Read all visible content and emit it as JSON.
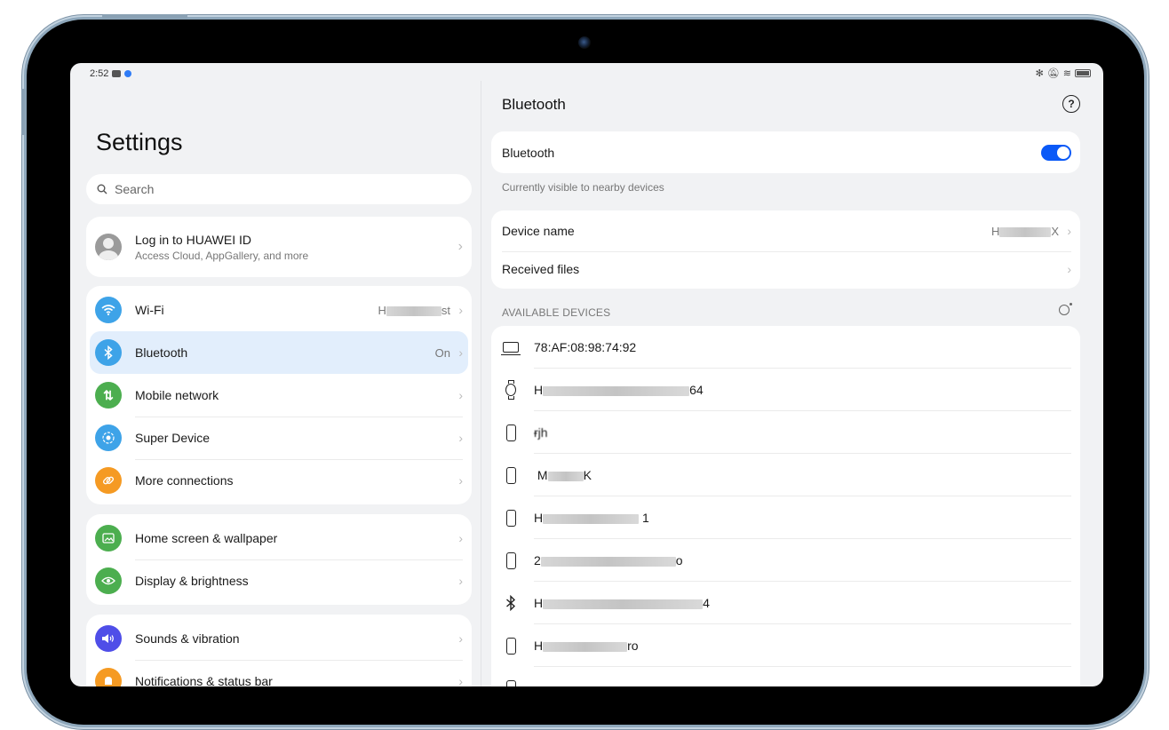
{
  "status_bar": {
    "time": "2:52",
    "right_icons": [
      "bluetooth-icon",
      "mute-icon",
      "wifi-icon",
      "battery-icon"
    ]
  },
  "left": {
    "title": "Settings",
    "search": {
      "placeholder": "Search"
    },
    "account": {
      "title": "Log in to HUAWEI ID",
      "subtitle": "Access Cloud, AppGallery, and more"
    },
    "groups": [
      {
        "items": [
          {
            "label": "Wi-Fi",
            "value_prefix": "H",
            "value_suffix": "st",
            "icon": "wifi-icon",
            "color": "#3ea3e8"
          },
          {
            "label": "Bluetooth",
            "value": "On",
            "icon": "bluetooth-icon",
            "color": "#3ea3e8",
            "selected": true
          },
          {
            "label": "Mobile network",
            "icon": "mobile-data-icon",
            "color": "#4cae4f"
          },
          {
            "label": "Super Device",
            "icon": "super-device-icon",
            "color": "#3ea3e8"
          },
          {
            "label": "More connections",
            "icon": "link-icon",
            "color": "#f59a23"
          }
        ]
      },
      {
        "items": [
          {
            "label": "Home screen & wallpaper",
            "icon": "wallpaper-icon",
            "color": "#4cae4f"
          },
          {
            "label": "Display & brightness",
            "icon": "eye-icon",
            "color": "#4cae4f"
          }
        ]
      },
      {
        "items": [
          {
            "label": "Sounds & vibration",
            "icon": "speaker-icon",
            "color": "#4f4ee8"
          },
          {
            "label": "Notifications & status bar",
            "icon": "bell-icon",
            "color": "#f59a23"
          }
        ]
      }
    ]
  },
  "right": {
    "header": "Bluetooth",
    "toggle_label": "Bluetooth",
    "toggle_on": true,
    "visibility_note": "Currently visible to nearby devices",
    "device_name_label": "Device name",
    "device_name_prefix": "H",
    "device_name_suffix": "X",
    "received_files_label": "Received files",
    "available_header": "AVAILABLE DEVICES",
    "devices": [
      {
        "type": "laptop",
        "name": "78:AF:08:98:74:92"
      },
      {
        "type": "watch",
        "name_prefix": "H",
        "name_suffix": "64"
      },
      {
        "type": "phone",
        "name": "ɍjh"
      },
      {
        "type": "phone",
        "name_prefix": "M",
        "name_suffix": "K"
      },
      {
        "type": "phone",
        "name_prefix": "H",
        "name_suffix": "1"
      },
      {
        "type": "phone",
        "name_prefix": "2",
        "name_suffix": "o"
      },
      {
        "type": "bluetooth",
        "name_prefix": "H",
        "name_suffix": "4"
      },
      {
        "type": "phone",
        "name_prefix": "H",
        "name_suffix": "ro"
      },
      {
        "type": "phone",
        "name": ""
      }
    ]
  },
  "colors": {
    "accent": "#0a59f7",
    "selected_row_bg": "#e2eefc",
    "screen_bg": "#f1f2f4"
  }
}
